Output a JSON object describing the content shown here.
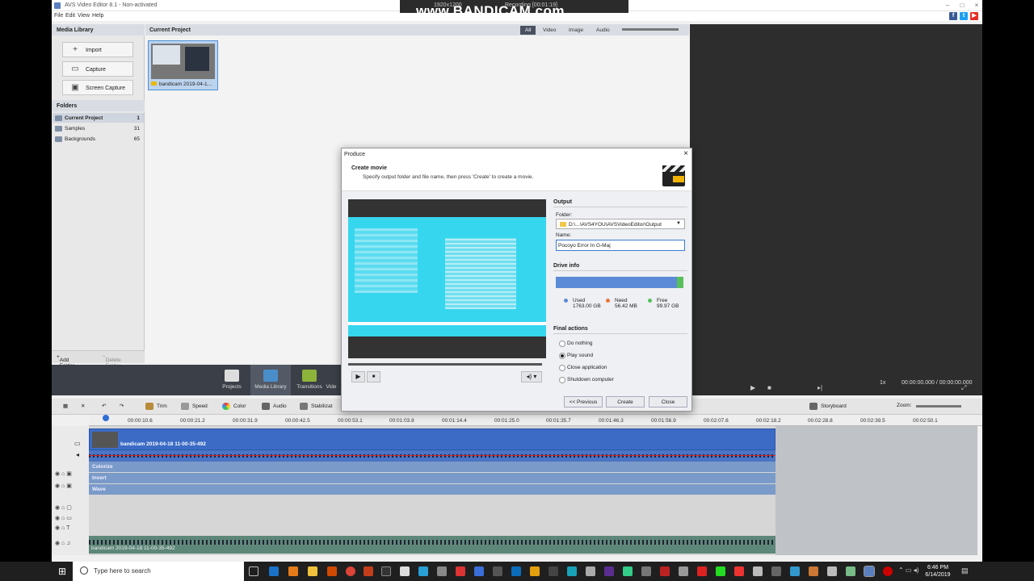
{
  "window": {
    "title": "AVS Video Editor 8.1 - Non-activated",
    "menu": [
      "File",
      "Edit",
      "View",
      "Help"
    ]
  },
  "recorder": {
    "resolution": "1920x1200",
    "recording": "Recording [00:01:19]",
    "watermark": "www.BANDICAM.com"
  },
  "media_library": {
    "title": "Media Library",
    "buttons": [
      "Import",
      "Capture",
      "Screen Capture"
    ],
    "folders_title": "Folders",
    "folders": [
      {
        "name": "Current Project",
        "count": "1"
      },
      {
        "name": "Samples",
        "count": "31"
      },
      {
        "name": "Backgrounds",
        "count": "65"
      }
    ],
    "add_folder": "Add Folder",
    "delete_folder": "Delete Folder"
  },
  "current_project": {
    "title": "Current Project",
    "filters": [
      "All",
      "Video",
      "Image",
      "Audio"
    ],
    "active_filter": "All",
    "clip_label": "bandicam 2019-04-1..."
  },
  "preview": {
    "speed": "1x",
    "timecode": "00:00:00.000 / 00:00:00.000"
  },
  "modes": [
    "Projects",
    "Media Library",
    "Transitions",
    "Vide"
  ],
  "edit_toolbar": {
    "trim": "Trim",
    "speed": "Speed",
    "color": "Color",
    "audio": "Audio",
    "stabilization": "Stabilizat",
    "storyboard": "Storyboard",
    "zoom": "Zoom:"
  },
  "ruler": [
    "00:00:10.6",
    "00:00:21.2",
    "00:00:31.9",
    "00:00:42.5",
    "00:00:53.1",
    "00:01:03.8",
    "00:01:14.4",
    "00:01:25.0",
    "00:01:35.7",
    "00:01:46.3",
    "00:01:56.9",
    "00:02:07.6",
    "00:02:18.2",
    "00:02:28.8",
    "00:02:39.5",
    "00:02:50.1"
  ],
  "timeline": {
    "video_clip": "bandicam 2019-04-18 11-00-35-492",
    "effects": [
      "Colorize",
      "Invert",
      "Wave"
    ],
    "audio_clip": "bandicam 2019-04-18 11-00-35-492"
  },
  "dialog": {
    "title": "Produce",
    "heading": "Create movie",
    "subtitle": "Specify output folder and file name, then press 'Create' to create a movie.",
    "output": "Output",
    "folder_label": "Folder:",
    "folder_value": "D:\\...\\AVS4YOU\\AVSVideoEditor\\Output",
    "name_label": "Name:",
    "name_value": "Pocoyo Error In G-Maj",
    "drive_info": "Drive info",
    "used_label": "Used",
    "used_value": "1763.00 GB",
    "need_label": "Need",
    "need_value": "56.42 MB",
    "free_label": "Free",
    "free_value": "99.97 GB",
    "final_actions": "Final actions",
    "actions": [
      "Do nothing",
      "Play sound",
      "Close application",
      "Shutdown computer"
    ],
    "selected_action": "Play sound",
    "btn_previous": "<< Previous",
    "btn_create": "Create",
    "btn_close": "Close"
  },
  "taskbar": {
    "search": "Type here to search",
    "time": "6:46 PM",
    "date": "6/14/2019"
  },
  "colors": {
    "accent": "#3b6bc5",
    "used": "#5b8bd6",
    "need": "#e8743b",
    "free": "#58c05b"
  }
}
